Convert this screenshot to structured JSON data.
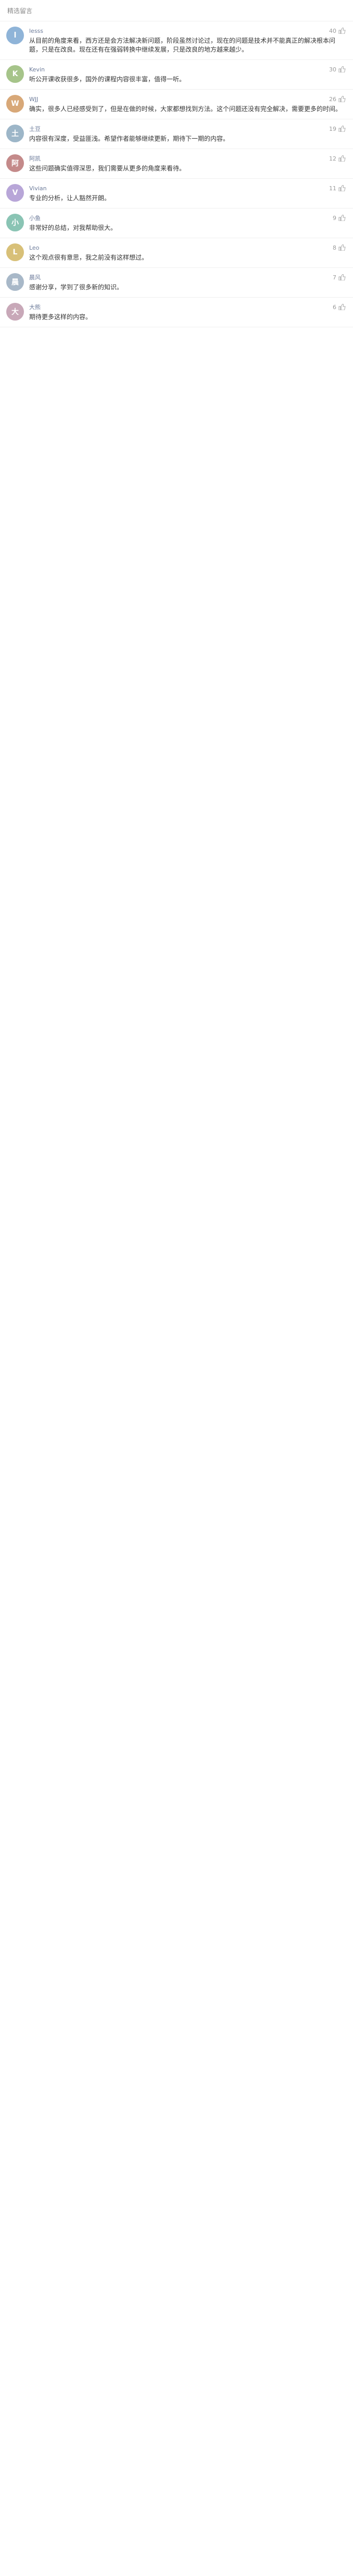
{
  "header": {
    "title": "精选留言"
  },
  "comments": [
    {
      "name": "lesss",
      "likes": "40",
      "text": "从目前的角度来看，西方还是会方法解决新问题，阶段虽然讨论过，现在的问题是技术并不能真正的解决根本问题，只是在改良。现在还有在强弱转换中继续发展，只是改良的地方越来越少。",
      "avatar_color": "#8fb4d8",
      "initial": "l"
    },
    {
      "name": "Kevin",
      "likes": "30",
      "text": "听公开课收获很多，国外的课程内容很丰富，值得一听。",
      "avatar_color": "#a6c48a",
      "initial": "K"
    },
    {
      "name": "WJJ",
      "likes": "26",
      "text": "确实，很多人已经感受到了，但是在做的时候，大家都想找到方法。这个问题还没有完全解决，需要更多的时间。",
      "avatar_color": "#d8a878",
      "initial": "W"
    },
    {
      "name": "土豆",
      "likes": "19",
      "text": "内容很有深度，受益匪浅。希望作者能够继续更新，期待下一期的内容。",
      "avatar_color": "#9db6c8",
      "initial": "土"
    },
    {
      "name": "阿凯",
      "likes": "12",
      "text": "这些问题确实值得深思，我们需要从更多的角度来看待。",
      "avatar_color": "#c48a8a",
      "initial": "阿"
    },
    {
      "name": "Vivian",
      "likes": "11",
      "text": "专业的分析，让人豁然开朗。",
      "avatar_color": "#b8a6d8",
      "initial": "V"
    },
    {
      "name": "小鱼",
      "likes": "9",
      "text": "非常好的总结，对我帮助很大。",
      "avatar_color": "#8ac4b4",
      "initial": "小"
    },
    {
      "name": "Leo",
      "likes": "8",
      "text": "这个观点很有意思，我之前没有这样想过。",
      "avatar_color": "#d8c078",
      "initial": "L"
    },
    {
      "name": "晨风",
      "likes": "7",
      "text": "感谢分享，学到了很多新的知识。",
      "avatar_color": "#a8b8c8",
      "initial": "晨"
    },
    {
      "name": "大熊",
      "likes": "6",
      "text": "期待更多这样的内容。",
      "avatar_color": "#c8a8b8",
      "initial": "大"
    }
  ]
}
